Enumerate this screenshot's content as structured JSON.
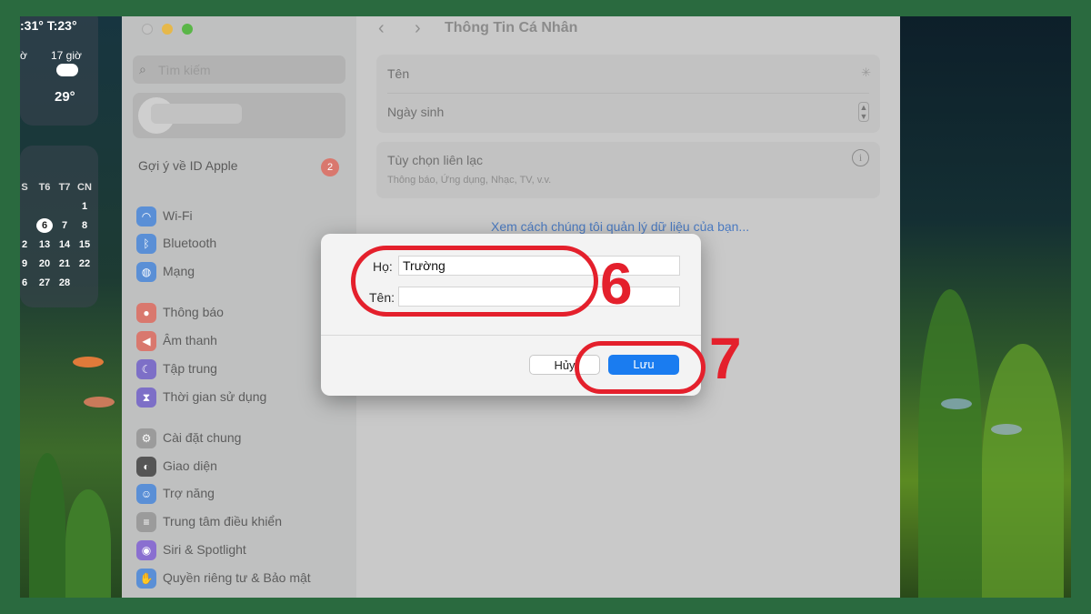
{
  "widgets": {
    "weather": {
      "header": ":31° T:23°",
      "hour_left": "ờ",
      "hour": "17 giờ",
      "temp": "29°",
      "icon": "cloud-icon"
    },
    "calendar": {
      "headers": [
        "S",
        "T6",
        "T7",
        "CN"
      ],
      "rows": [
        [
          "",
          "",
          "",
          "1"
        ],
        [
          "",
          "6",
          "7",
          "8"
        ],
        [
          "2",
          "13",
          "14",
          "15"
        ],
        [
          "9",
          "20",
          "21",
          "22"
        ],
        [
          "6",
          "27",
          "28",
          ""
        ]
      ],
      "today": "6"
    }
  },
  "sidebar": {
    "search_placeholder": "Tìm kiếm",
    "apple_id_label": "Gợi ý về ID Apple",
    "apple_id_badge": "2",
    "items": [
      {
        "label": "Wi-Fi",
        "icon": "wifi-icon",
        "color": "#5a8fd6"
      },
      {
        "label": "Bluetooth",
        "icon": "bluetooth-icon",
        "color": "#5a8fd6"
      },
      {
        "label": "Mạng",
        "icon": "globe-icon",
        "color": "#5a8fd6"
      },
      {
        "label": "Thông báo",
        "icon": "bell-icon",
        "color": "#d9786e"
      },
      {
        "label": "Âm thanh",
        "icon": "speaker-icon",
        "color": "#d9786e"
      },
      {
        "label": "Tập trung",
        "icon": "moon-icon",
        "color": "#7d6fc7"
      },
      {
        "label": "Thời gian sử dụng",
        "icon": "hourglass-icon",
        "color": "#7d6fc7"
      },
      {
        "label": "Cài đặt chung",
        "icon": "gear-icon",
        "color": "#9b9b9b"
      },
      {
        "label": "Giao diện",
        "icon": "appearance-icon",
        "color": "#555555"
      },
      {
        "label": "Trợ năng",
        "icon": "accessibility-icon",
        "color": "#5a8fd6"
      },
      {
        "label": "Trung tâm điều khiển",
        "icon": "control-center-icon",
        "color": "#9b9b9b"
      },
      {
        "label": "Siri & Spotlight",
        "icon": "siri-icon",
        "color": "#8a6fd0"
      },
      {
        "label": "Quyền riêng tư & Bảo mật",
        "icon": "hand-icon",
        "color": "#5a8fd6"
      }
    ]
  },
  "main": {
    "title": "Thông Tin Cá Nhân",
    "name_label": "Tên",
    "birthday_label": "Ngày sinh",
    "contact_label": "Tùy chọn liên lạc",
    "contact_sub": "Thông báo, Ứng dụng, Nhạc, TV, v.v.",
    "data_link": "Xem cách chúng tôi quản lý dữ liệu của bạn..."
  },
  "dialog": {
    "last_name_label": "Họ:",
    "last_name_value": "Trường",
    "first_name_label": "Tên:",
    "first_name_value": "",
    "cancel": "Hủy",
    "save": "Lưu"
  },
  "annotations": {
    "step1": "6",
    "step2": "7",
    "color": "#e4202c"
  }
}
